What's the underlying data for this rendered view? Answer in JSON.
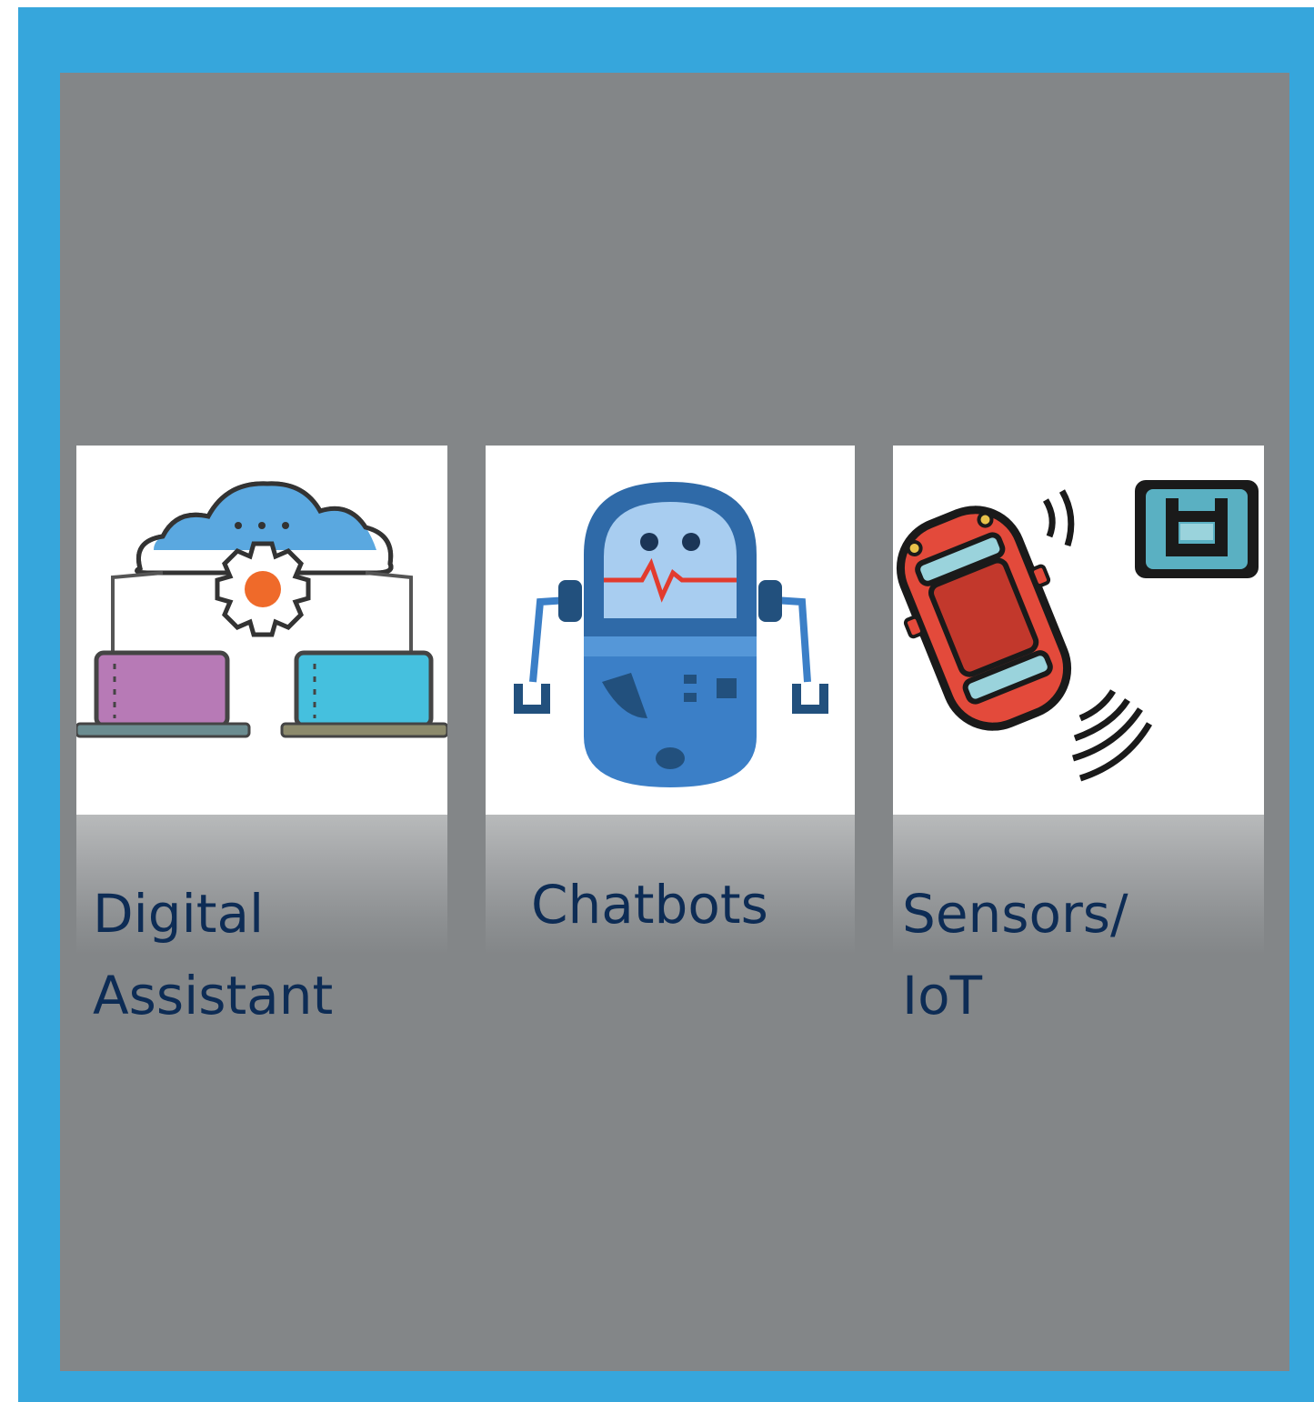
{
  "cards": [
    {
      "label": "Digital\nAssistant",
      "icon": "cloud-gear-laptops-icon"
    },
    {
      "label": "Chatbots",
      "icon": "robot-icon"
    },
    {
      "label": "Sensors/\nIoT",
      "icon": "car-sensor-icon"
    }
  ],
  "colors": {
    "frame": "#36a6dc",
    "panel": "#838688",
    "label": "#0d2c55"
  }
}
